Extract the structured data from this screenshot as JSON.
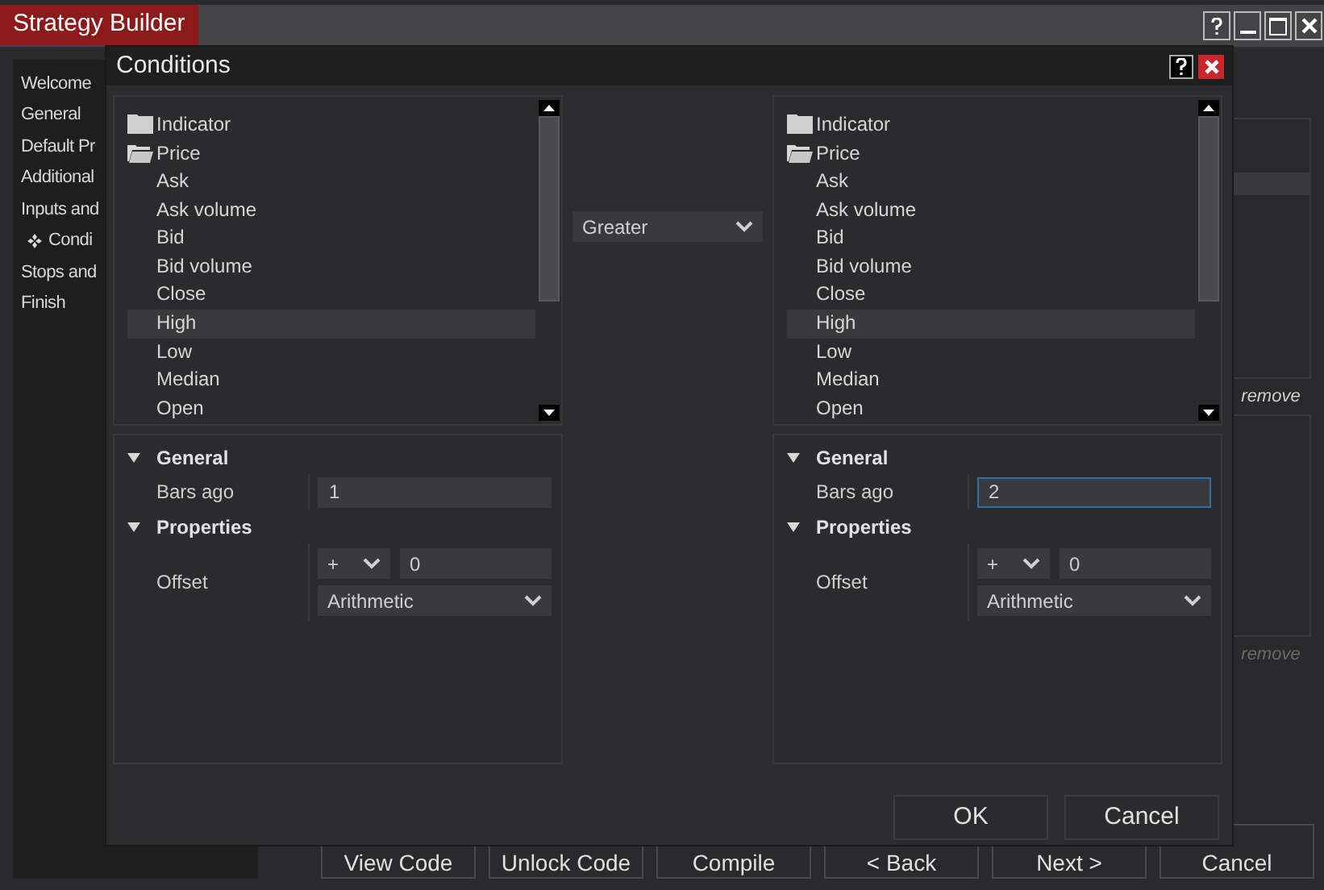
{
  "window": {
    "title": "Strategy Builder"
  },
  "nav": [
    {
      "label": "Welcome",
      "kind": "item"
    },
    {
      "label": "General",
      "kind": "item"
    },
    {
      "label": "Default Pr",
      "kind": "item"
    },
    {
      "label": "Additional",
      "kind": "item"
    },
    {
      "label": "Inputs and",
      "kind": "item"
    },
    {
      "label": "Condi",
      "kind": "sub"
    },
    {
      "label": "Stops and",
      "kind": "item"
    },
    {
      "label": "Finish",
      "kind": "item"
    }
  ],
  "side_panel": {
    "remove_links": [
      {
        "label": "remove",
        "disabled": false
      },
      {
        "label": "remove",
        "disabled": true
      }
    ]
  },
  "footer_buttons": [
    "View Code",
    "Unlock Code",
    "Compile",
    "< Back",
    "Next >",
    "Cancel"
  ],
  "dialog": {
    "title": "Conditions",
    "operator": "Greater",
    "buttons": [
      "OK",
      "Cancel"
    ],
    "sides": [
      {
        "tree": [
          {
            "label": "Indicator",
            "expanded": false
          },
          {
            "label": "Price",
            "expanded": true,
            "children": [
              {
                "label": "Ask",
                "selected": false
              },
              {
                "label": "Ask volume",
                "selected": false
              },
              {
                "label": "Bid",
                "selected": false
              },
              {
                "label": "Bid volume",
                "selected": false
              },
              {
                "label": "Close",
                "selected": false
              },
              {
                "label": "High",
                "selected": true
              },
              {
                "label": "Low",
                "selected": false
              },
              {
                "label": "Median",
                "selected": false
              },
              {
                "label": "Open",
                "selected": false
              }
            ]
          }
        ],
        "sections": [
          {
            "title": "General",
            "expanded": true,
            "rows": [
              {
                "kind": "text",
                "label": "Bars ago",
                "value": "1",
                "focused": false
              }
            ]
          },
          {
            "title": "Properties",
            "expanded": true,
            "rows": [
              {
                "kind": "offset",
                "label": "Offset",
                "operator": "+",
                "value": "0",
                "mode": "Arithmetic"
              }
            ]
          }
        ]
      },
      {
        "tree": [
          {
            "label": "Indicator",
            "expanded": false
          },
          {
            "label": "Price",
            "expanded": true,
            "children": [
              {
                "label": "Ask",
                "selected": false
              },
              {
                "label": "Ask volume",
                "selected": false
              },
              {
                "label": "Bid",
                "selected": false
              },
              {
                "label": "Bid volume",
                "selected": false
              },
              {
                "label": "Close",
                "selected": false
              },
              {
                "label": "High",
                "selected": true
              },
              {
                "label": "Low",
                "selected": false
              },
              {
                "label": "Median",
                "selected": false
              },
              {
                "label": "Open",
                "selected": false
              }
            ]
          }
        ],
        "sections": [
          {
            "title": "General",
            "expanded": true,
            "rows": [
              {
                "kind": "text",
                "label": "Bars ago",
                "value": "2",
                "focused": true
              }
            ]
          },
          {
            "title": "Properties",
            "expanded": true,
            "rows": [
              {
                "kind": "offset",
                "label": "Offset",
                "operator": "+",
                "value": "0",
                "mode": "Arithmetic"
              }
            ]
          }
        ]
      }
    ]
  }
}
